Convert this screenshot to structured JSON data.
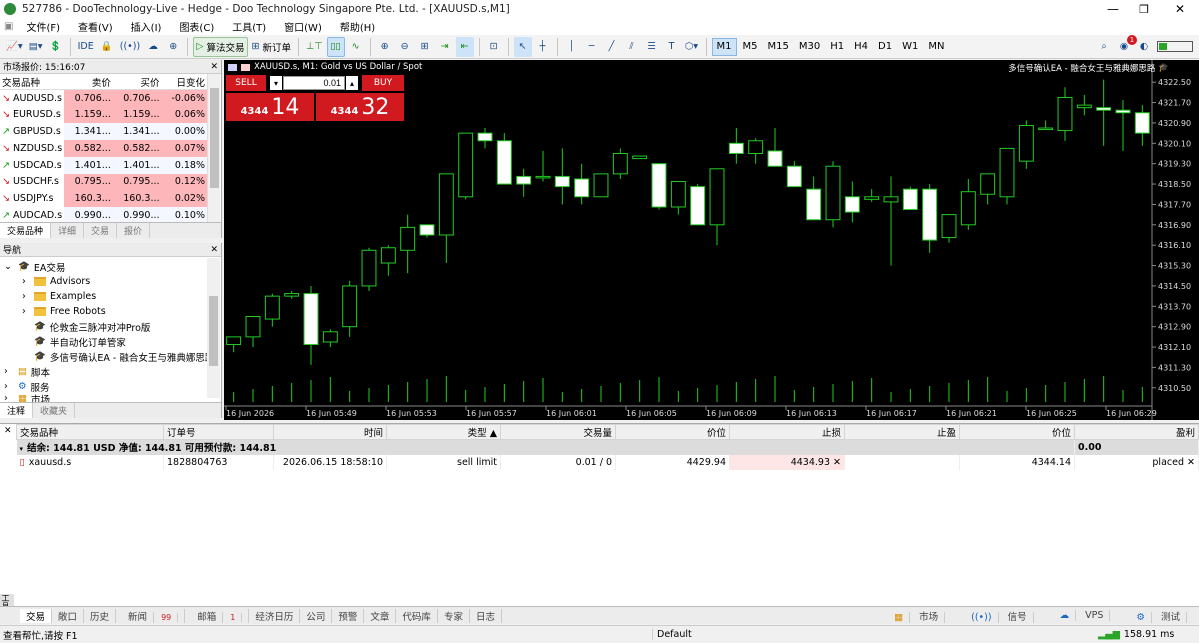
{
  "window": {
    "title": "527786 - DooTechnology-Live - Hedge - Doo Technology Singapore Pte. Ltd. - [XAUUSD.s,M1]"
  },
  "menu": [
    "文件(F)",
    "查看(V)",
    "插入(I)",
    "图表(C)",
    "工具(T)",
    "窗口(W)",
    "帮助(H)"
  ],
  "toolbar": {
    "algo_label": "算法交易",
    "new_order_label": "新订单",
    "ide_label": "IDE",
    "timeframes": [
      "M1",
      "M5",
      "M15",
      "M30",
      "H1",
      "H4",
      "D1",
      "W1",
      "MN"
    ],
    "selected_timeframe": "M1",
    "notifications": "1"
  },
  "market_watch": {
    "title": "市场报价: 15:16:07",
    "headers": [
      "交易品种",
      "卖价",
      "买价",
      "日变化"
    ],
    "rows": [
      {
        "symbol": "AUDUSD.s",
        "bid": "0.706...",
        "ask": "0.706...",
        "change": "-0.06%",
        "dir": "dn"
      },
      {
        "symbol": "EURUSD.s",
        "bid": "1.159...",
        "ask": "1.159...",
        "change": "0.06%",
        "dir": "dn"
      },
      {
        "symbol": "GBPUSD.s",
        "bid": "1.341...",
        "ask": "1.341...",
        "change": "0.00%",
        "dir": "up"
      },
      {
        "symbol": "NZDUSD.s",
        "bid": "0.582...",
        "ask": "0.582...",
        "change": "0.07%",
        "dir": "dn"
      },
      {
        "symbol": "USDCAD.s",
        "bid": "1.401...",
        "ask": "1.401...",
        "change": "0.18%",
        "dir": "up"
      },
      {
        "symbol": "USDCHF.s",
        "bid": "0.795...",
        "ask": "0.795...",
        "change": "0.12%",
        "dir": "dn"
      },
      {
        "symbol": "USDJPY.s",
        "bid": "160.3...",
        "ask": "160.3...",
        "change": "0.02%",
        "dir": "dn"
      },
      {
        "symbol": "AUDCAD.s",
        "bid": "0.990...",
        "ask": "0.990...",
        "change": "0.10%",
        "dir": "up"
      }
    ],
    "tabs": [
      "交易品种",
      "详细",
      "交易",
      "报价"
    ]
  },
  "navigator": {
    "title": "导航",
    "root": "EA交易",
    "items": [
      "Advisors",
      "Examples",
      "Free Robots",
      "伦敦金三脉冲对冲Pro版",
      "半自动化订单管家",
      "多信号确认EA - 融合女王与雅典娜思路"
    ],
    "items2": [
      "脚本",
      "服务",
      "市场"
    ],
    "tabs": [
      "注释",
      "收藏夹"
    ]
  },
  "chart": {
    "header": "XAUUSD.s, M1:  Gold vs US Dollar / Spot",
    "ea_label": "多信号确认EA - 融合女王与雅典娜思路",
    "sell_label": "SELL",
    "buy_label": "BUY",
    "lot": "0.01",
    "sell_big": "14",
    "sell_small": "4344",
    "buy_big": "32",
    "buy_small": "4344",
    "price_labels": [
      "4322.50",
      "4321.70",
      "4320.90",
      "4320.10",
      "4319.30",
      "4318.50",
      "4317.70",
      "4316.90",
      "4316.10",
      "4315.30",
      "4314.50",
      "4313.70",
      "4312.90",
      "4312.10",
      "4311.30",
      "4310.50"
    ],
    "time_labels": [
      "16 Jun 2026",
      "16 Jun 05:49",
      "16 Jun 05:53",
      "16 Jun 05:57",
      "16 Jun 06:01",
      "16 Jun 06:05",
      "16 Jun 06:09",
      "16 Jun 06:13",
      "16 Jun 06:17",
      "16 Jun 06:21",
      "16 Jun 06:25",
      "16 Jun 06:29"
    ]
  },
  "chart_data": {
    "type": "candlestick",
    "ylim": [
      4310.1,
      4322.9
    ],
    "candles": [
      {
        "o": 4312.2,
        "h": 4312.5,
        "l": 4311.9,
        "c": 4312.5
      },
      {
        "o": 4312.5,
        "h": 4313.1,
        "l": 4312.1,
        "c": 4313.3
      },
      {
        "o": 4313.2,
        "h": 4314.2,
        "l": 4312.9,
        "c": 4314.1
      },
      {
        "o": 4314.1,
        "h": 4314.3,
        "l": 4314.0,
        "c": 4314.2
      },
      {
        "o": 4314.2,
        "h": 4314.5,
        "l": 4311.4,
        "c": 4312.2
      },
      {
        "o": 4312.3,
        "h": 4312.8,
        "l": 4312.1,
        "c": 4312.7
      },
      {
        "o": 4312.9,
        "h": 4314.7,
        "l": 4312.5,
        "c": 4314.5
      },
      {
        "o": 4314.5,
        "h": 4316.0,
        "l": 4314.3,
        "c": 4315.9
      },
      {
        "o": 4315.4,
        "h": 4316.1,
        "l": 4314.9,
        "c": 4316.0
      },
      {
        "o": 4315.9,
        "h": 4317.3,
        "l": 4315.0,
        "c": 4316.8
      },
      {
        "o": 4316.9,
        "h": 4316.9,
        "l": 4316.4,
        "c": 4316.5
      },
      {
        "o": 4316.5,
        "h": 4318.6,
        "l": 4315.4,
        "c": 4318.9
      },
      {
        "o": 4318.0,
        "h": 4320.5,
        "l": 4317.9,
        "c": 4320.5
      },
      {
        "o": 4320.5,
        "h": 4320.7,
        "l": 4319.9,
        "c": 4320.2
      },
      {
        "o": 4320.2,
        "h": 4320.5,
        "l": 4318.7,
        "c": 4318.5
      },
      {
        "o": 4318.8,
        "h": 4319.1,
        "l": 4318.0,
        "c": 4318.5
      },
      {
        "o": 4318.8,
        "h": 4319.8,
        "l": 4318.6,
        "c": 4318.8
      },
      {
        "o": 4318.8,
        "h": 4319.9,
        "l": 4317.7,
        "c": 4318.4
      },
      {
        "o": 4318.7,
        "h": 4319.3,
        "l": 4317.7,
        "c": 4318.0
      },
      {
        "o": 4318.0,
        "h": 4318.9,
        "l": 4318.0,
        "c": 4318.9
      },
      {
        "o": 4318.9,
        "h": 4319.9,
        "l": 4318.7,
        "c": 4319.7
      },
      {
        "o": 4319.5,
        "h": 4319.6,
        "l": 4319.5,
        "c": 4319.6
      },
      {
        "o": 4319.3,
        "h": 4319.3,
        "l": 4317.5,
        "c": 4317.6
      },
      {
        "o": 4317.6,
        "h": 4318.6,
        "l": 4317.3,
        "c": 4318.6
      },
      {
        "o": 4318.4,
        "h": 4318.5,
        "l": 4316.9,
        "c": 4316.9
      },
      {
        "o": 4316.9,
        "h": 4319.1,
        "l": 4316.1,
        "c": 4319.1
      },
      {
        "o": 4320.1,
        "h": 4320.7,
        "l": 4319.3,
        "c": 4319.7
      },
      {
        "o": 4319.7,
        "h": 4320.3,
        "l": 4319.3,
        "c": 4320.2
      },
      {
        "o": 4319.8,
        "h": 4320.7,
        "l": 4319.3,
        "c": 4319.2
      },
      {
        "o": 4319.2,
        "h": 4319.4,
        "l": 4318.5,
        "c": 4318.4
      },
      {
        "o": 4318.3,
        "h": 4318.8,
        "l": 4317.4,
        "c": 4317.1
      },
      {
        "o": 4317.1,
        "h": 4319.4,
        "l": 4316.8,
        "c": 4319.2
      },
      {
        "o": 4318.0,
        "h": 4318.6,
        "l": 4317.0,
        "c": 4317.4
      },
      {
        "o": 4317.9,
        "h": 4318.3,
        "l": 4317.8,
        "c": 4318.0
      },
      {
        "o": 4317.8,
        "h": 4318.8,
        "l": 4315.3,
        "c": 4318.0
      },
      {
        "o": 4318.3,
        "h": 4318.4,
        "l": 4317.9,
        "c": 4317.5
      },
      {
        "o": 4318.3,
        "h": 4318.5,
        "l": 4315.8,
        "c": 4316.3
      },
      {
        "o": 4316.4,
        "h": 4317.3,
        "l": 4316.2,
        "c": 4317.3
      },
      {
        "o": 4316.9,
        "h": 4318.7,
        "l": 4316.7,
        "c": 4318.2
      },
      {
        "o": 4318.1,
        "h": 4318.9,
        "l": 4317.7,
        "c": 4318.9
      },
      {
        "o": 4318.0,
        "h": 4319.4,
        "l": 4317.7,
        "c": 4319.9
      },
      {
        "o": 4319.4,
        "h": 4321.0,
        "l": 4319.1,
        "c": 4320.8
      },
      {
        "o": 4320.7,
        "h": 4321.0,
        "l": 4320.7,
        "c": 4320.7
      },
      {
        "o": 4320.6,
        "h": 4322.3,
        "l": 4320.2,
        "c": 4321.9
      },
      {
        "o": 4321.5,
        "h": 4322.0,
        "l": 4321.2,
        "c": 4321.6
      },
      {
        "o": 4321.5,
        "h": 4322.6,
        "l": 4320.0,
        "c": 4321.4
      },
      {
        "o": 4321.4,
        "h": 4321.8,
        "l": 4319.8,
        "c": 4321.3
      },
      {
        "o": 4321.3,
        "h": 4321.6,
        "l": 4320.0,
        "c": 4320.5
      }
    ]
  },
  "terminal": {
    "headers": [
      "交易品种",
      "订单号",
      "时间",
      "类型 ▲",
      "交易量",
      "价位",
      "止损",
      "止盈",
      "价位",
      "盈利"
    ],
    "balance_text": "结余: 144.81 USD  净值: 144.81  可用预付款: 144.81",
    "balance_value": "0.00",
    "order": {
      "symbol": "xauusd.s",
      "ticket": "1828804763",
      "time": "2026.06.15 18:58:10",
      "type": "sell limit",
      "volume": "0.01 / 0",
      "price": "4429.94",
      "sl": "4434.93",
      "tp": "",
      "cur_price": "4344.14",
      "state": "placed"
    }
  },
  "bottom_tabs": [
    "交易",
    "敞口",
    "历史",
    "新闻",
    "邮箱",
    "经济日历",
    "公司",
    "预警",
    "文章",
    "代码库",
    "专家",
    "日志"
  ],
  "news_badge": "99",
  "mail_badge": "1",
  "status": {
    "help": "查看帮忙,请按 F1",
    "profile": "Default",
    "right": [
      "市场",
      "信号",
      "VPS",
      "测试"
    ],
    "ping": "158.91 ms",
    "side_label": "工具箱"
  }
}
